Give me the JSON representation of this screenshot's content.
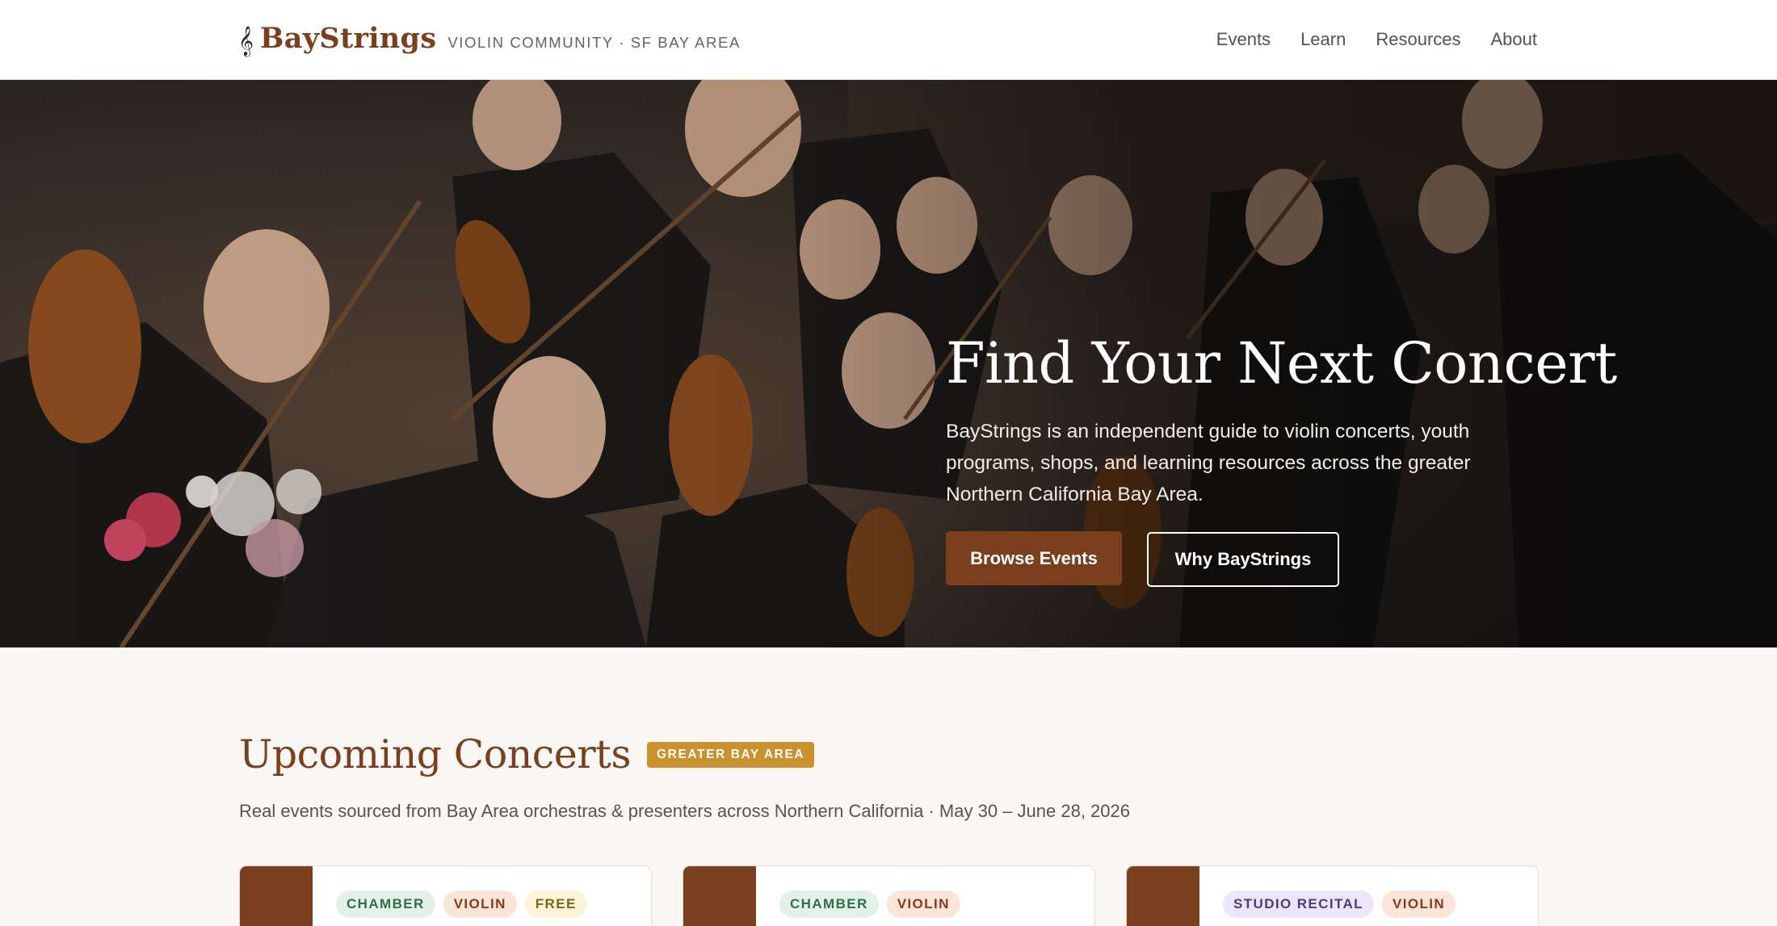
{
  "header": {
    "clef": "𝄞",
    "brand": "BayStrings",
    "tagline": "VIOLIN COMMUNITY · SF BAY AREA",
    "nav": [
      "Events",
      "Learn",
      "Resources",
      "About"
    ]
  },
  "hero": {
    "title": "Find Your Next Concert",
    "description": "BayStrings is an independent guide to violin concerts, youth programs, shops, and learning resources across the greater Northern California Bay Area.",
    "primary_button": "Browse Events",
    "secondary_button": "Why BayStrings"
  },
  "upcoming": {
    "title": "Upcoming Concerts",
    "badge": "GREATER BAY AREA",
    "subtitle": "Real events sourced from Bay Area orchestras & presenters across Northern California · May 30 – June 28, 2026",
    "cards": [
      {
        "tags": [
          "CHAMBER",
          "VIOLIN",
          "FREE"
        ]
      },
      {
        "tags": [
          "CHAMBER",
          "VIOLIN"
        ]
      },
      {
        "tags": [
          "STUDIO RECITAL",
          "VIOLIN"
        ]
      }
    ]
  },
  "colors": {
    "brand_brown": "#7b3f1e",
    "badge_gold": "#c9922e",
    "page_bg": "#f9f7f4"
  }
}
